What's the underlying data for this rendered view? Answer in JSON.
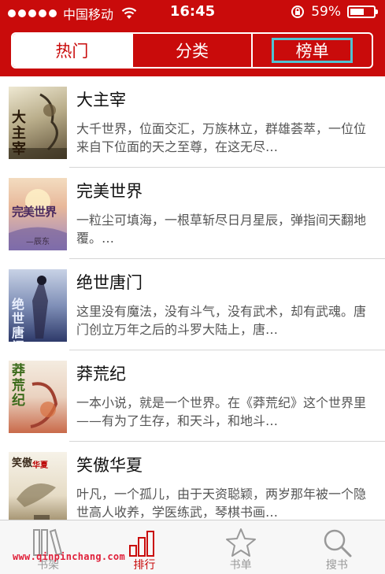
{
  "status_bar": {
    "carrier": "中国移动",
    "time": "16:45",
    "battery_percent": "59%",
    "battery_level": 0.59
  },
  "segments": [
    {
      "label": "热门",
      "active": true
    },
    {
      "label": "分类",
      "active": false
    },
    {
      "label": "榜单",
      "active": false
    }
  ],
  "books": [
    {
      "title": "大主宰",
      "description": "大千世界，位面交汇，万族林立，群雄荟萃，一位位来自下位面的天之至尊，在这无尽…",
      "cover_text": "大主宰",
      "cover_colors": [
        "#e8e2c8",
        "#7a6a4a"
      ]
    },
    {
      "title": "完美世界",
      "description": "一粒尘可填海，一根草斩尽日月星辰，弹指间天翻地覆。…",
      "cover_text": "完美世界",
      "cover_author": "—辰东",
      "cover_colors": [
        "#e9c9a0",
        "#8a6fb0"
      ]
    },
    {
      "title": "绝世唐门",
      "description": "这里没有魔法，没有斗气，没有武术，却有武魂。唐门创立万年之后的斗罗大陆上，唐…",
      "cover_text": "绝世唐门",
      "cover_colors": [
        "#b8c4d8",
        "#3b4a78"
      ]
    },
    {
      "title": "莽荒纪",
      "description": "一本小说，就是一个世界。在《莽荒纪》这个世界里——有为了生存，和天斗，和地斗…",
      "cover_text": "莽荒纪",
      "cover_colors": [
        "#f0e6d8",
        "#c0583a"
      ]
    },
    {
      "title": "笑傲华夏",
      "description": "叶凡，一个孤儿，由于天资聪颖，两岁那年被一个隐世高人收养，学医练武，琴棋书画…",
      "cover_text": "笑傲",
      "cover_tag": "华夏",
      "cover_colors": [
        "#f3efe4",
        "#8c7a5a"
      ]
    }
  ],
  "tabbar": [
    {
      "label": "书架",
      "icon": "bookshelf-icon",
      "active": false
    },
    {
      "label": "排行",
      "icon": "ranking-bars-icon",
      "active": true
    },
    {
      "label": "书单",
      "icon": "star-icon",
      "active": false
    },
    {
      "label": "搜书",
      "icon": "search-icon",
      "active": false
    }
  ],
  "watermark": "www.qinpinchang.com",
  "colors": {
    "header_red": "#c90b0b",
    "segment_focus": "#4fc3d3",
    "tab_active": "#c90b0b",
    "tab_inactive": "#999999"
  }
}
